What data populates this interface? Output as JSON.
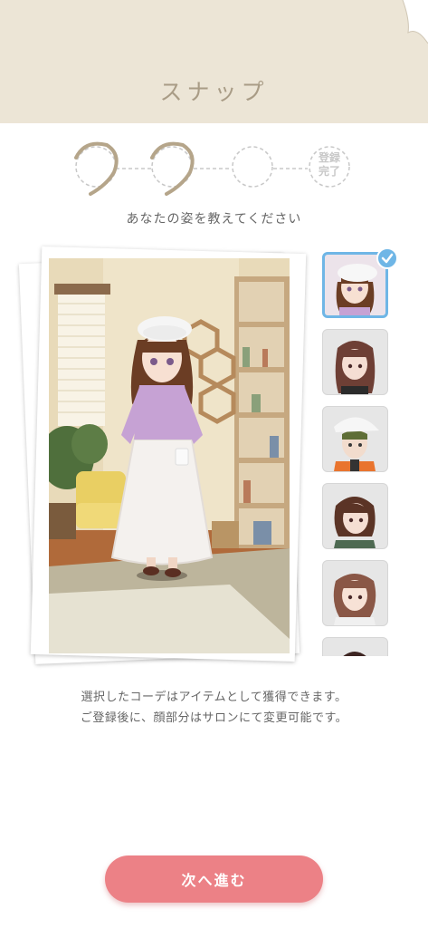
{
  "header": {
    "title": "スナップ"
  },
  "steps": {
    "final_label": "登録\n完了"
  },
  "subtitle": "あなたの姿を教えてください",
  "avatars": [
    {
      "name": "avatar-option-1",
      "selected": true
    },
    {
      "name": "avatar-option-2",
      "selected": false
    },
    {
      "name": "avatar-option-3",
      "selected": false
    },
    {
      "name": "avatar-option-4",
      "selected": false
    },
    {
      "name": "avatar-option-5",
      "selected": false
    },
    {
      "name": "avatar-option-6",
      "selected": false
    }
  ],
  "note": {
    "line1": "選択したコーデはアイテムとして獲得できます。",
    "line2": "ご登録後に、顔部分はサロンにて変更可能です。"
  },
  "next_button": {
    "label": "次へ進む"
  },
  "colors": {
    "header_bg": "#ece5d6",
    "accent_blue": "#6fb6e6",
    "button": "#ec8186",
    "step_done": "#b5a58a"
  }
}
